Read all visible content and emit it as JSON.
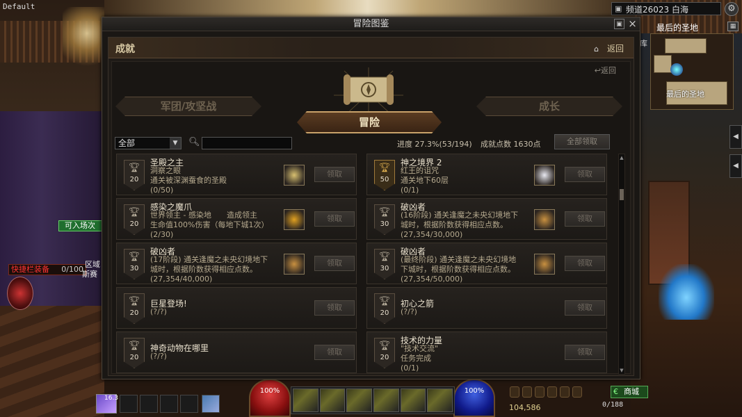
{
  "hud": {
    "default_label": "Default",
    "channel": "频道26023 白海",
    "map_title": "最后的圣地",
    "minimap_label": "最后的圣地",
    "minimap_side": "库",
    "enter_badge": "可入场次",
    "quick_equip_label": "快捷栏装备",
    "quick_equip_count": "0/100",
    "left_text_1": "区域",
    "left_text_2": "斯赛",
    "hp_text": "100%",
    "mp_text": "100%",
    "char_level": "16.3",
    "gold": "104,586",
    "fatigue": "0/188",
    "shop_label": "商城"
  },
  "window": {
    "title": "冒险图鉴",
    "page_title": "成就",
    "back_label": "返回",
    "sub_back_label": "返回",
    "tabs": {
      "left": "军团/攻坚战",
      "center": "冒险",
      "right": "成长"
    },
    "filter": {
      "selected": "全部",
      "search_placeholder": ""
    },
    "progress": "进度 27.3%(53/194)",
    "points": "成就点数 1630点",
    "claim_all": "全部领取",
    "claim_label": "领取",
    "achievements": [
      {
        "title": "圣殿之主",
        "desc": "洞察之眼\n通关被深渊蚕食的圣殿",
        "progress": "(0/50)",
        "points": "20",
        "gold": false,
        "reward_icon": "map-scroll-icon",
        "reward_color": "#d8c070"
      },
      {
        "title": "神之境界 2",
        "desc": "红王的诅咒\n通关地下60层",
        "progress": "(0/1)",
        "points": "50",
        "gold": true,
        "reward_icon": "letter-icon",
        "reward_color": "#e8e8f0"
      },
      {
        "title": "感染之魔爪",
        "desc": "世界领主 - 感染地　　造成领主\n生命值100%伤害（每地下城1次）",
        "progress": "(2/30)",
        "points": "20",
        "gold": false,
        "reward_icon": "gold-star-icon",
        "reward_color": "#e0a020"
      },
      {
        "title": "破凶者",
        "desc": "(16阶段) 通关逢魔之未央幻境地下\n城时，根据阶数获得相应点数。",
        "progress": "(27,354/30,000)",
        "points": "30",
        "gold": false,
        "reward_icon": "emblem-icon",
        "reward_color": "#c89040"
      },
      {
        "title": "破凶者",
        "desc": "(17阶段) 通关逢魔之未央幻境地下\n城时，根据阶数获得相应点数。",
        "progress": "(27,354/40,000)",
        "points": "30",
        "gold": false,
        "reward_icon": "emblem-icon",
        "reward_color": "#c89040"
      },
      {
        "title": "破凶者",
        "desc": "(最终阶段) 通关逢魔之未央幻境地\n下城时，根据阶数获得相应点数。",
        "progress": "(27,354/50,000)",
        "points": "30",
        "gold": false,
        "reward_icon": "emblem-icon",
        "reward_color": "#c89040"
      },
      {
        "title": "巨星登场!",
        "desc": "",
        "progress": "(?/?)",
        "points": "20",
        "gold": false,
        "reward_icon": "",
        "reward_color": ""
      },
      {
        "title": "初心之箭",
        "desc": "",
        "progress": "(?/?)",
        "points": "20",
        "gold": false,
        "reward_icon": "",
        "reward_color": ""
      },
      {
        "title": "神奇动物在哪里",
        "desc": "",
        "progress": "(?/?)",
        "points": "20",
        "gold": false,
        "reward_icon": "",
        "reward_color": ""
      },
      {
        "title": "技术的力量",
        "desc": "\"技术交流\"\n任务完成",
        "progress": "(0/1)",
        "points": "20",
        "gold": false,
        "reward_icon": "",
        "reward_color": ""
      }
    ]
  }
}
